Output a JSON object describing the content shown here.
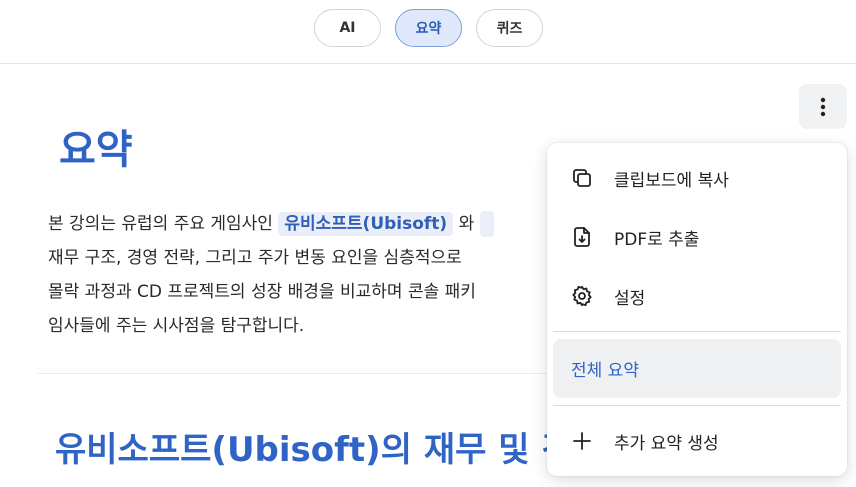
{
  "tabs": [
    {
      "label": "AI"
    },
    {
      "label": "요약"
    },
    {
      "label": "퀴즈"
    }
  ],
  "content": {
    "title": "요약",
    "paragraph": {
      "line1_prefix": "본 강의는 유럽의 주요 게임사인 ",
      "line1_tag": "유비소프트(Ubisoft)",
      "line1_suffix": " 와 ",
      "line2": "재무 구조, 경영 전략, 그리고 주가 변동 요인을 심층적으로 ",
      "line3": "몰락 과정과 CD 프로젝트의 성장 배경을 비교하며 콘솔 패키",
      "line4": "임사들에 주는 시사점을 탐구합니다."
    },
    "heading2": "유비소프트(Ubisoft)의 재무 및 경영"
  },
  "menu": {
    "items": [
      {
        "label": "클립보드에 복사",
        "icon": "copy-icon"
      },
      {
        "label": "PDF로 추출",
        "icon": "file-download-icon"
      },
      {
        "label": "설정",
        "icon": "gear-icon"
      },
      {
        "label": "전체 요약",
        "icon": ""
      },
      {
        "label": "추가 요약 생성",
        "icon": "plus-icon"
      }
    ]
  },
  "colors": {
    "accent": "#2f63c6",
    "active_tab_bg": "#dfe9fb"
  }
}
